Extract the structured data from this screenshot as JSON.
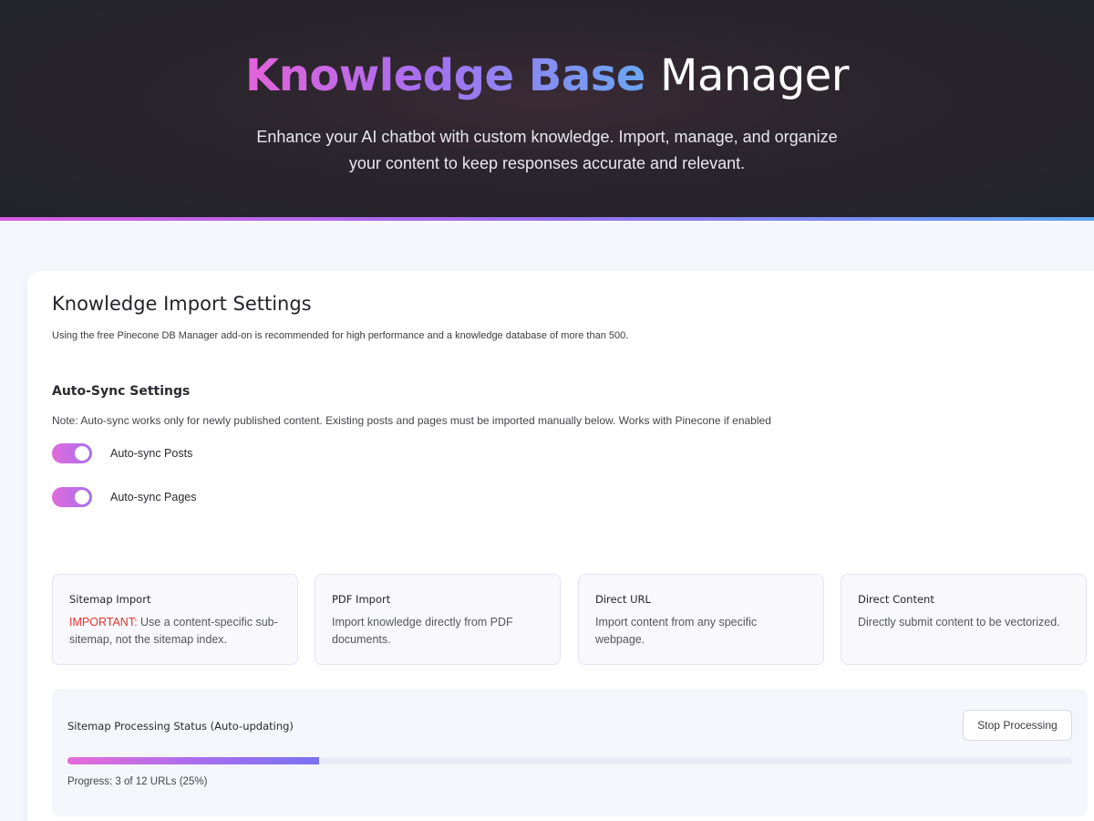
{
  "header": {
    "title_gradient": "Knowledge Base",
    "title_plain": "Manager",
    "subtitle": "Enhance your AI chatbot with custom knowledge. Import, manage, and organize your content to keep responses accurate and relevant."
  },
  "settings": {
    "title": "Knowledge Import Settings",
    "description": "Using the free Pinecone DB Manager add-on is recommended for high performance and a knowledge database of more than 500."
  },
  "auto_sync": {
    "title": "Auto-Sync Settings",
    "note": "Note: Auto-sync works only for newly published content. Existing posts and pages must be imported manually below. Works with Pinecone if enabled",
    "toggles": [
      {
        "label": "Auto-sync Posts",
        "enabled": true
      },
      {
        "label": "Auto-sync Pages",
        "enabled": true
      }
    ]
  },
  "import_methods": [
    {
      "title": "Sitemap Import",
      "important": "IMPORTANT:",
      "description": " Use a content-specific sub-sitemap, not the sitemap index."
    },
    {
      "title": "PDF Import",
      "description": "Import knowledge directly from PDF documents."
    },
    {
      "title": "Direct URL",
      "description": "Import content from any specific webpage."
    },
    {
      "title": "Direct Content",
      "description": "Directly submit content to be vectorized."
    }
  ],
  "status": {
    "title": "Sitemap Processing Status (Auto-updating)",
    "stop_label": "Stop Processing",
    "progress_percent": 25,
    "progress_text": "Progress: 3 of 12 URLs (25%)"
  }
}
